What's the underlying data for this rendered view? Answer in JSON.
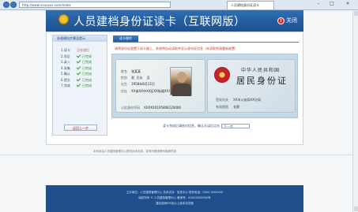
{
  "browser": {
    "address": "http://www.xxxxxxx.com/index",
    "tab_title": "人员建档身份证读卡",
    "back_label": "←",
    "forward_label": "→",
    "minimize": "–",
    "maximize": "□",
    "close": "×"
  },
  "header": {
    "title": "人员建档身份证读卡（互联网版）",
    "close_label": "关闭"
  },
  "sidebar": {
    "title": "办理建档步骤及提示",
    "steps": [
      {
        "num": "1.读卡",
        "status": "正在进行",
        "done": false
      },
      {
        "num": "2.验证",
        "status": "已完成",
        "done": true
      },
      {
        "num": "3.录入",
        "status": "已完成",
        "done": true
      },
      {
        "num": "4.采集",
        "status": "已完成",
        "done": true
      },
      {
        "num": "5.确认",
        "status": "已完成",
        "done": true
      },
      {
        "num": "6.提交",
        "status": "已完成",
        "done": true
      },
      {
        "num": "7.完成",
        "status": "已完成",
        "done": true
      }
    ],
    "button_label": "返回上一步"
  },
  "main": {
    "tab_label": "读卡操作",
    "instruction": "请将身份证放置于读卡器上，系统将自动读取并显示身份证信息（未读取到请重新放置）"
  },
  "id_front": {
    "name_label": "姓名",
    "name_value": "张某某",
    "sex_label": "性别",
    "sex_value": "男",
    "nation_label": "民族",
    "nation_value": "汉",
    "birth_label": "出生",
    "birth_value": "1958年8月12日",
    "address_label": "住址",
    "address_value": "XX省XX市XX区XX街道XX号",
    "number_label": "公民身份号码",
    "number_value": "XXXXXX195808120000"
  },
  "id_back": {
    "nation_title": "中华人民共和国",
    "card_title": "居民身份证",
    "authority_label": "签发机关",
    "authority_value": "XX市公安局XX分局",
    "valid_label": "有效期限",
    "valid_value": "长期"
  },
  "bottom": {
    "prompt": "读卡完成后请核对信息，确认无误后点击",
    "input_value": "下一步"
  },
  "mid_note": "本系统由人员建档管理中心提供技术支持，如有问题请联系客服热线",
  "footer": {
    "line1": "主办单位：人员建档管理中心  技术支持：信息中心  联系电话：0000-0000000",
    "line2": "版权所有 © 人员建档管理中心  备案号：XXX00000000号",
    "line3": "建议使用IE8及以上版本浏览器"
  }
}
